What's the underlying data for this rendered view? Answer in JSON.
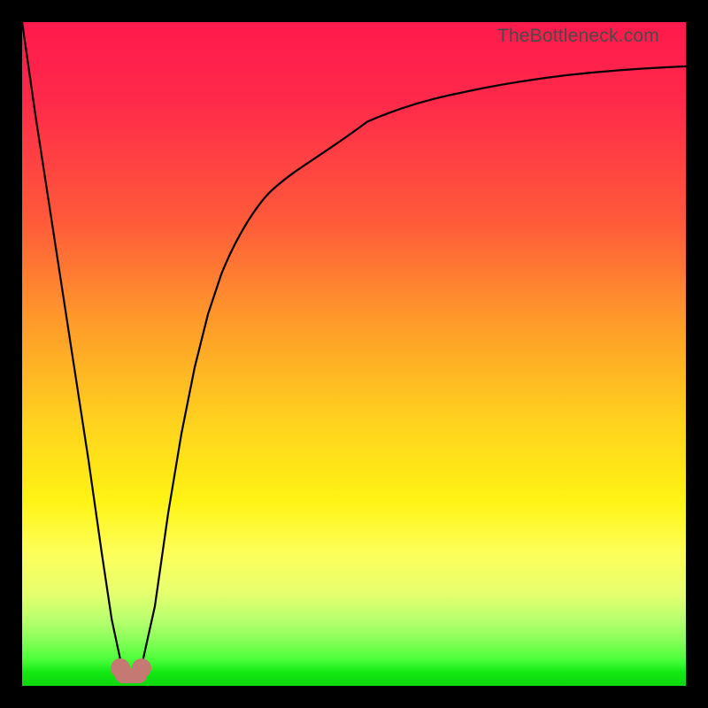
{
  "watermark": {
    "text": "TheBottleneck.com"
  },
  "colors": {
    "bg_black": "#000000",
    "curve": "#000000",
    "blob": "#c47a72",
    "gradient_stops": [
      "#ff1a4d",
      "#ff2a4a",
      "#ff5a3a",
      "#ff9a2a",
      "#ffd11e",
      "#fff314",
      "#fdff5a",
      "#e7ff6e",
      "#b9ff6e",
      "#8aff5a",
      "#4cff3a",
      "#12e812",
      "#0ed60e"
    ]
  },
  "chart_data": {
    "type": "line",
    "title": "",
    "xlabel": "",
    "ylabel": "",
    "xlim": [
      0,
      100
    ],
    "ylim": [
      0,
      100
    ],
    "grid": false,
    "legend": false,
    "series": [
      {
        "name": "bottleneck-curve",
        "x": [
          0,
          2,
          4,
          6,
          8,
          10,
          12,
          13.5,
          15,
          16,
          17,
          18,
          20,
          22,
          24,
          26,
          28,
          30,
          34,
          38,
          42,
          46,
          52,
          58,
          66,
          74,
          82,
          90,
          100
        ],
        "y": [
          100,
          86,
          73,
          60,
          47,
          34,
          20,
          10,
          3,
          1,
          1,
          3,
          12,
          26,
          38,
          48,
          56,
          62,
          70,
          75,
          79,
          82,
          85,
          87,
          89,
          90.5,
          91.5,
          92.3,
          93
        ]
      }
    ],
    "annotations": [
      {
        "name": "minimum-marker",
        "x_range": [
          15,
          18
        ],
        "y": 1,
        "shape": "rounded-double-lobe",
        "color": "#c47a72"
      }
    ]
  }
}
